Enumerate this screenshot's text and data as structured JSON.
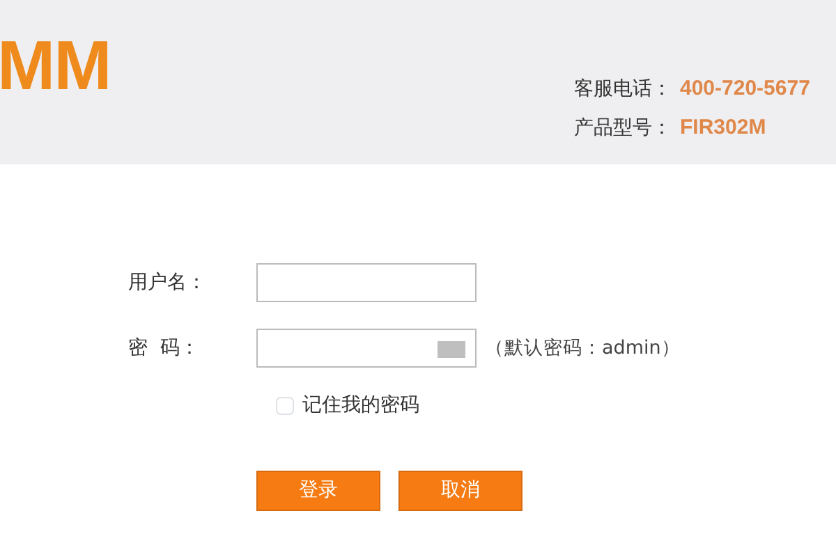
{
  "header": {
    "logo": "MM",
    "info": [
      {
        "label": "客服电话：",
        "value": "400-720-5677"
      },
      {
        "label": "产品型号：",
        "value": "FIR302M"
      }
    ]
  },
  "form": {
    "fields": [
      {
        "label": "用户名：",
        "kind": "text"
      },
      {
        "label": "密  码：",
        "kind": "password",
        "hint": "（默认密码：admin）"
      }
    ],
    "remember": {
      "label": "记住我的密码",
      "checked": false
    },
    "buttons": [
      "登录",
      "取消"
    ]
  }
}
